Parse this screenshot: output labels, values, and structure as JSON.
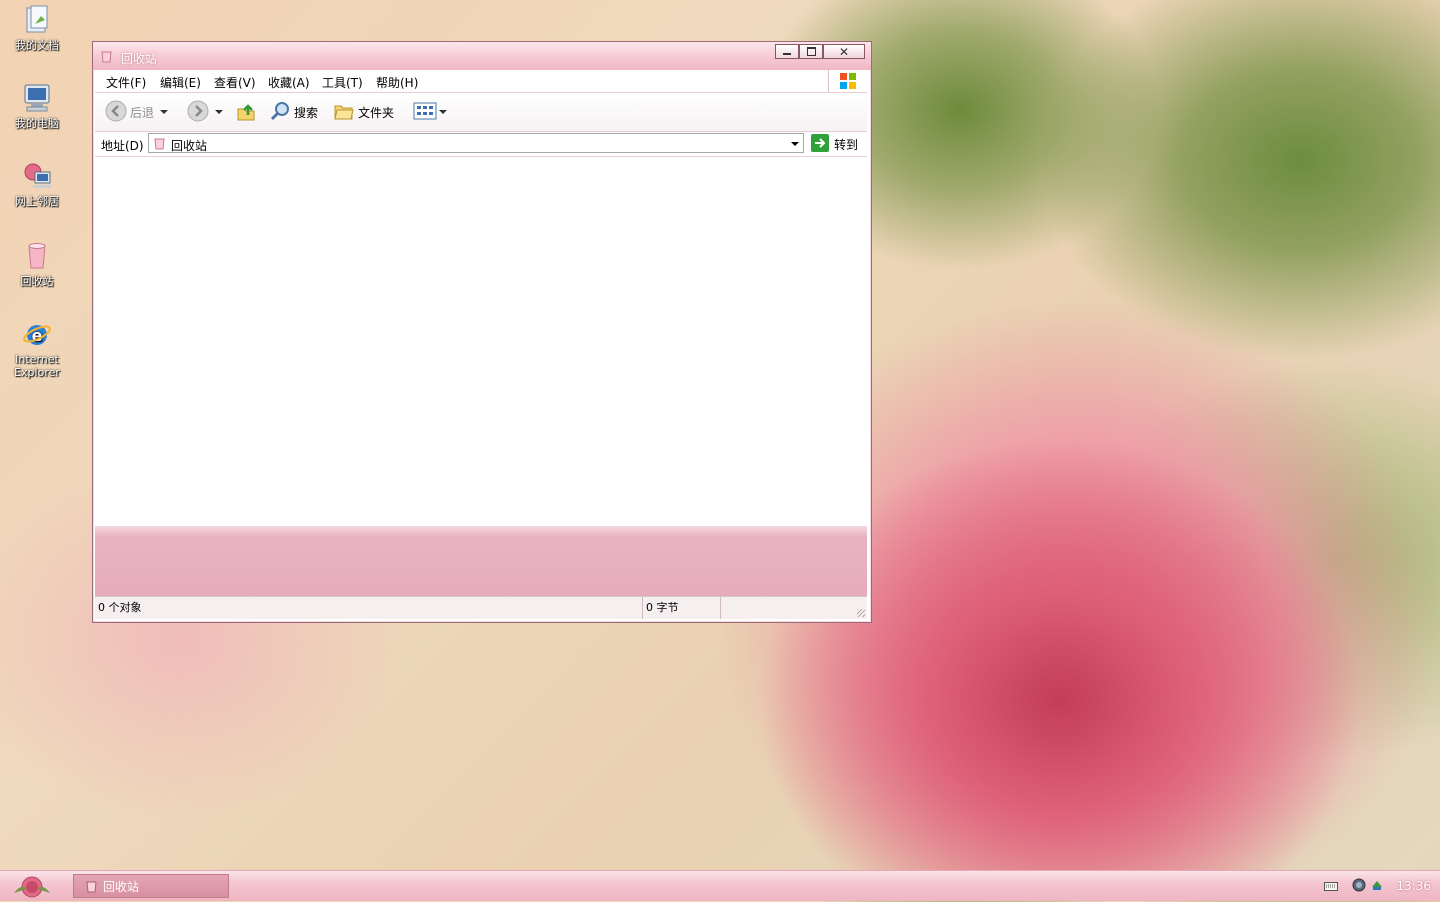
{
  "desktop": {
    "icons": [
      {
        "label": "我的文档"
      },
      {
        "label": "我的电脑"
      },
      {
        "label": "网上邻居"
      },
      {
        "label": "回收站"
      },
      {
        "label": "Internet Explorer"
      }
    ]
  },
  "window": {
    "title": "回收站",
    "menu": [
      "文件(F)",
      "编辑(E)",
      "查看(V)",
      "收藏(A)",
      "工具(T)",
      "帮助(H)"
    ],
    "toolbar": {
      "back": "后退",
      "search": "搜索",
      "folders": "文件夹"
    },
    "address": {
      "label": "地址(D)",
      "value": "回收站",
      "go": "转到"
    },
    "status": {
      "objects": "0 个对象",
      "size": "0 字节"
    }
  },
  "taskbar": {
    "task_title": "回收站",
    "clock": "13:36"
  },
  "colors": {
    "accent": "#efb5c3",
    "title_text": "#ffffff"
  }
}
